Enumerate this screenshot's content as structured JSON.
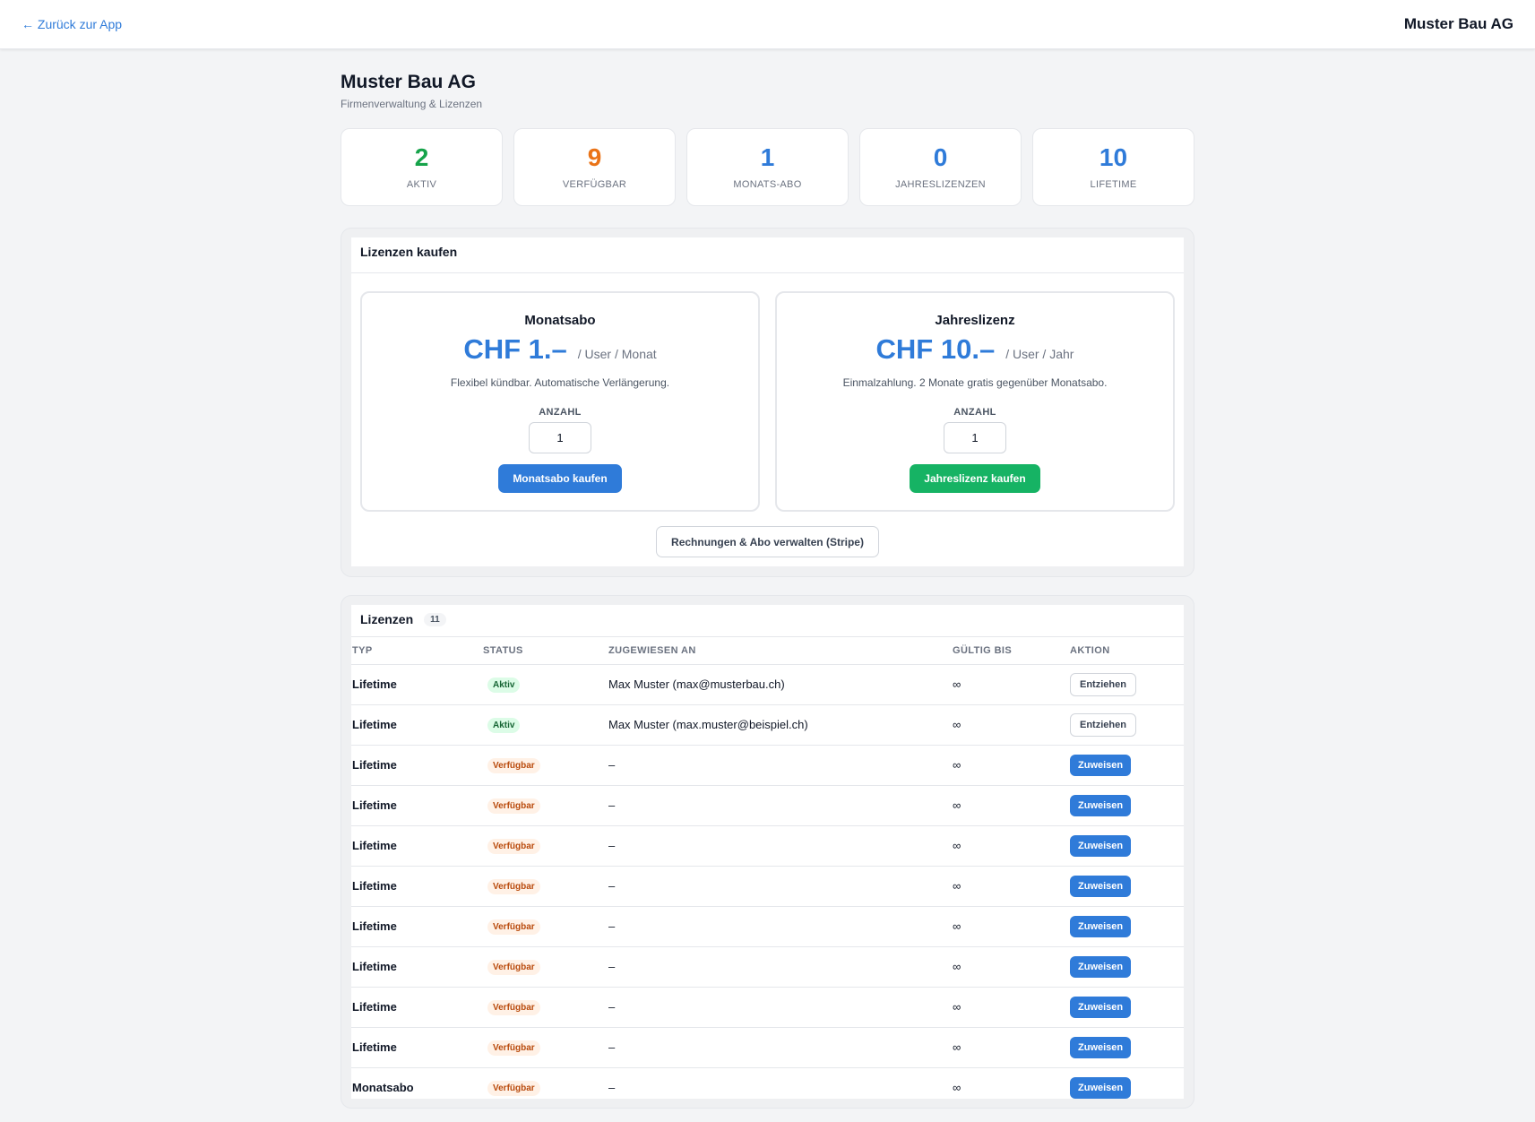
{
  "topbar": {
    "back_label": "← Zurück zur App",
    "company": "Muster Bau AG"
  },
  "page": {
    "title": "Muster Bau AG",
    "subtitle": "Firmenverwaltung & Lizenzen"
  },
  "stats": [
    {
      "value": "2",
      "label": "AKTIV",
      "color": "#16a34a"
    },
    {
      "value": "9",
      "label": "VERFÜGBAR",
      "color": "#ea7317"
    },
    {
      "value": "1",
      "label": "MONATS-ABO",
      "color": "#2f7bd9"
    },
    {
      "value": "0",
      "label": "JAHRESLIZENZEN",
      "color": "#2f7bd9"
    },
    {
      "value": "10",
      "label": "LIFETIME",
      "color": "#2f7bd9"
    }
  ],
  "purchase": {
    "title": "Lizenzen kaufen",
    "plans": [
      {
        "name": "Monatsabo",
        "price": "CHF 1.–",
        "unit": "/ User / Monat",
        "description": "Flexibel kündbar. Automatische Verlängerung.",
        "qty_label": "ANZAHL",
        "qty_value": "1",
        "button": "Monatsabo kaufen",
        "button_color": "#2f7bd9"
      },
      {
        "name": "Jahreslizenz",
        "price": "CHF 10.–",
        "unit": "/ User / Jahr",
        "description": "Einmalzahlung. 2 Monate gratis gegenüber Monatsabo.",
        "qty_label": "ANZAHL",
        "qty_value": "1",
        "button": "Jahreslizenz kaufen",
        "button_color": "#16b364"
      }
    ],
    "manage_button": "Rechnungen & Abo verwalten (Stripe)"
  },
  "licenses": {
    "title": "Lizenzen",
    "count": "11",
    "columns": [
      "TYP",
      "STATUS",
      "ZUGEWIESEN AN",
      "GÜLTIG BIS",
      "AKTION"
    ],
    "rows": [
      {
        "type": "Lifetime",
        "status": "Aktiv",
        "status_kind": "active",
        "assigned": "Max Muster (max@musterbau.ch)",
        "valid_until": "∞",
        "action": "Entziehen",
        "action_kind": "outline"
      },
      {
        "type": "Lifetime",
        "status": "Aktiv",
        "status_kind": "active",
        "assigned": "Max Muster (max.muster@beispiel.ch)",
        "valid_until": "∞",
        "action": "Entziehen",
        "action_kind": "outline"
      },
      {
        "type": "Lifetime",
        "status": "Verfügbar",
        "status_kind": "available",
        "assigned": "–",
        "valid_until": "∞",
        "action": "Zuweisen",
        "action_kind": "primary"
      },
      {
        "type": "Lifetime",
        "status": "Verfügbar",
        "status_kind": "available",
        "assigned": "–",
        "valid_until": "∞",
        "action": "Zuweisen",
        "action_kind": "primary"
      },
      {
        "type": "Lifetime",
        "status": "Verfügbar",
        "status_kind": "available",
        "assigned": "–",
        "valid_until": "∞",
        "action": "Zuweisen",
        "action_kind": "primary"
      },
      {
        "type": "Lifetime",
        "status": "Verfügbar",
        "status_kind": "available",
        "assigned": "–",
        "valid_until": "∞",
        "action": "Zuweisen",
        "action_kind": "primary"
      },
      {
        "type": "Lifetime",
        "status": "Verfügbar",
        "status_kind": "available",
        "assigned": "–",
        "valid_until": "∞",
        "action": "Zuweisen",
        "action_kind": "primary"
      },
      {
        "type": "Lifetime",
        "status": "Verfügbar",
        "status_kind": "available",
        "assigned": "–",
        "valid_until": "∞",
        "action": "Zuweisen",
        "action_kind": "primary"
      },
      {
        "type": "Lifetime",
        "status": "Verfügbar",
        "status_kind": "available",
        "assigned": "–",
        "valid_until": "∞",
        "action": "Zuweisen",
        "action_kind": "primary"
      },
      {
        "type": "Lifetime",
        "status": "Verfügbar",
        "status_kind": "available",
        "assigned": "–",
        "valid_until": "∞",
        "action": "Zuweisen",
        "action_kind": "primary"
      },
      {
        "type": "Monatsabo",
        "status": "Verfügbar",
        "status_kind": "available",
        "assigned": "–",
        "valid_until": "∞",
        "action": "Zuweisen",
        "action_kind": "primary"
      }
    ]
  }
}
